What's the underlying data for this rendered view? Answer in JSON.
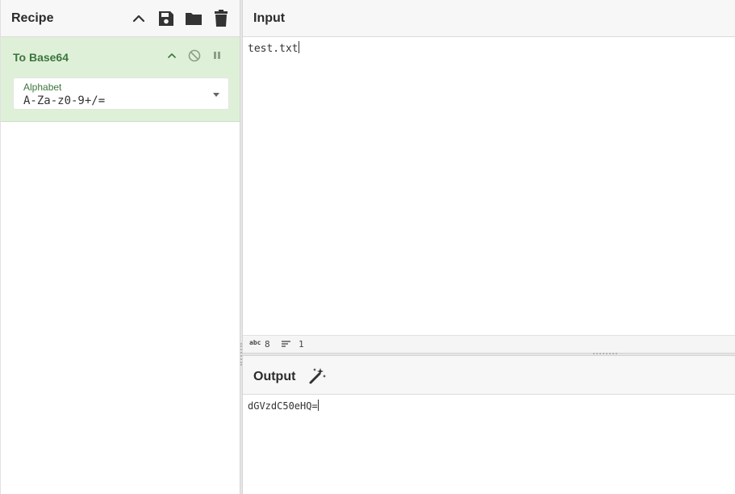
{
  "recipe": {
    "title": "Recipe",
    "buttons": [
      "collapse-all",
      "save",
      "load",
      "clear"
    ]
  },
  "operation": {
    "name": "To Base64",
    "arg_label": "Alphabet",
    "arg_value": "A-Za-z0-9+/="
  },
  "input": {
    "title": "Input",
    "text": "test.txt",
    "status": {
      "length_icon": "abc",
      "length": "8",
      "lines": "1"
    }
  },
  "output": {
    "title": "Output",
    "text": "dGVzdC50eHQ="
  },
  "colors": {
    "operation_bg": "#dff0d8",
    "operation_text": "#3c763d",
    "header_bg": "#f7f7f7"
  }
}
